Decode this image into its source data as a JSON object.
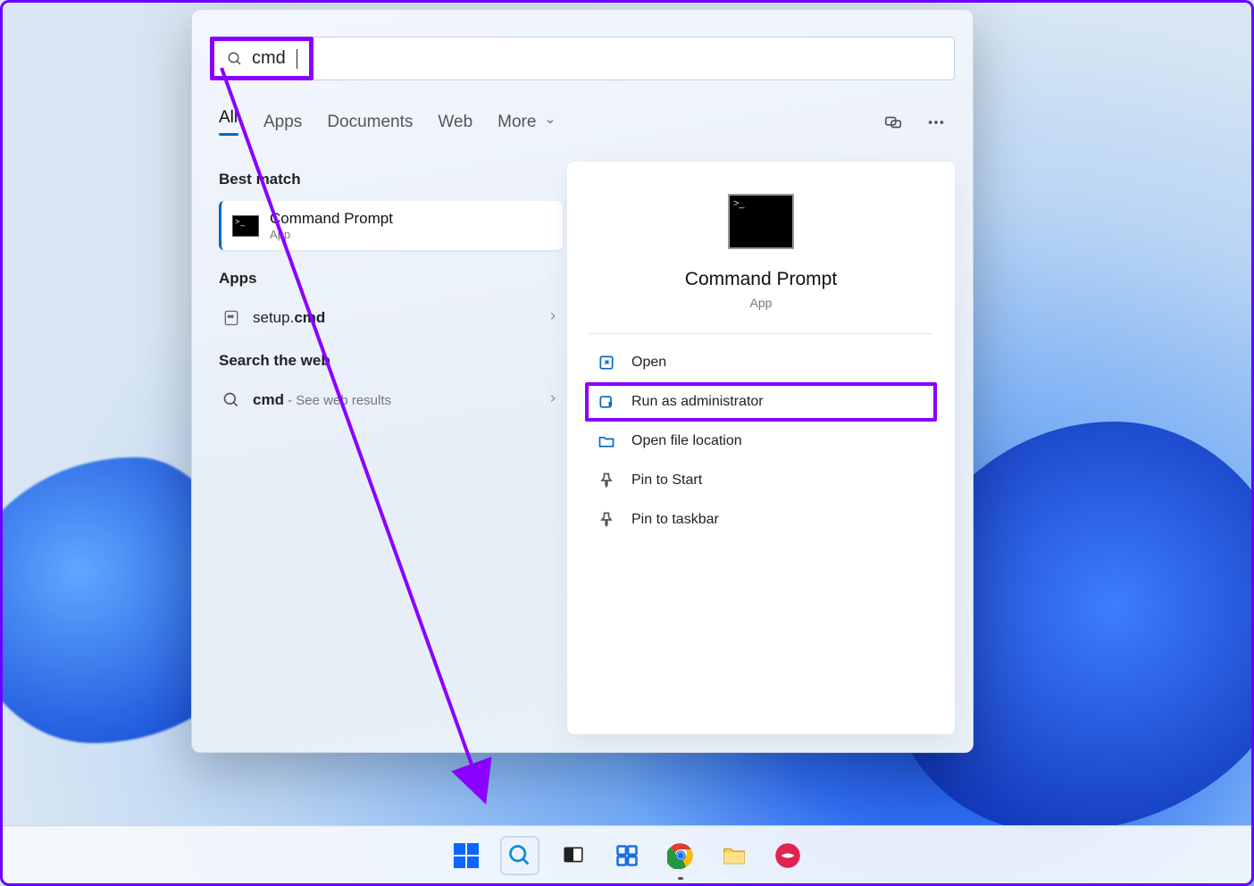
{
  "search": {
    "query": "cmd"
  },
  "tabs": {
    "all": "All",
    "apps": "Apps",
    "documents": "Documents",
    "web": "Web",
    "more": "More"
  },
  "sections": {
    "best_match": "Best match",
    "apps": "Apps",
    "search_web": "Search the web"
  },
  "best_match": {
    "title": "Command Prompt",
    "subtitle": "App"
  },
  "apps_list": {
    "item0_prefix": "setup.",
    "item0_bold": "cmd"
  },
  "web_list": {
    "item0_bold": "cmd",
    "item0_suffix": " - See web results"
  },
  "details": {
    "title": "Command Prompt",
    "subtitle": "App",
    "actions": {
      "open": "Open",
      "run_admin": "Run as administrator",
      "open_loc": "Open file location",
      "pin_start": "Pin to Start",
      "pin_taskbar": "Pin to taskbar"
    }
  }
}
